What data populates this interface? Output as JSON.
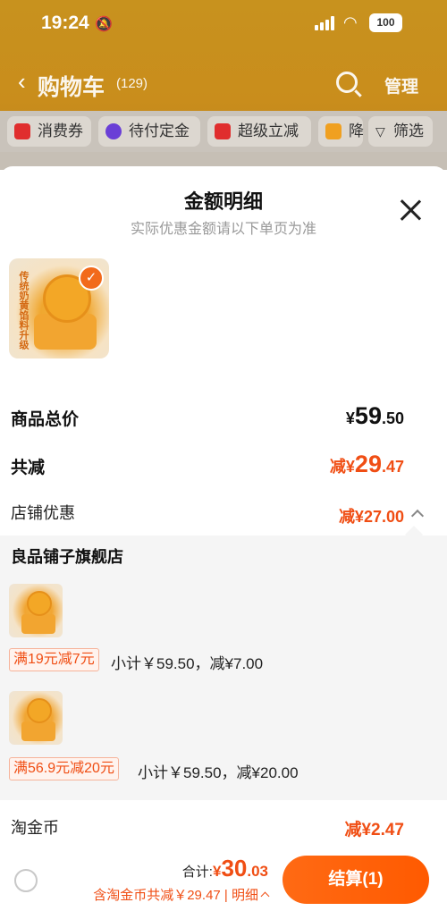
{
  "status_bar": {
    "time": "19:24",
    "battery": "100"
  },
  "nav": {
    "title": "购物车",
    "count": "(129)",
    "manage": "管理"
  },
  "chips": [
    {
      "label": "消费券",
      "color": "#e02e2e"
    },
    {
      "label": "待付定金",
      "color": "#6a3fd6"
    },
    {
      "label": "超级立减",
      "color": "#e02e2e"
    },
    {
      "label": "降",
      "color": "#f0a020"
    }
  ],
  "filter_label": "筛选",
  "sheet": {
    "title": "金额明细",
    "subtitle": "实际优惠金额请以下单页为准",
    "product_thumb_text": "传统奶黄馅料升级"
  },
  "total": {
    "label": "商品总价",
    "symbol": "¥",
    "int": "59",
    "dec": ".50"
  },
  "reduction": {
    "label": "共减",
    "prefix": "减",
    "symbol": "¥",
    "int": "29",
    "dec": ".47"
  },
  "shop_discount": {
    "label": "店铺优惠",
    "value": "减¥27.00"
  },
  "store": {
    "name": "良品铺子旗舰店",
    "items": [
      {
        "promo": "满19元减7元",
        "subtotal": "小计￥59.50，减¥7.00"
      },
      {
        "promo": "满56.9元减20元",
        "subtotal": "小计￥59.50，减¥20.00"
      }
    ]
  },
  "coins": {
    "label": "淘金币",
    "value": "减¥2.47"
  },
  "checkout": {
    "sum_label": "合计:",
    "sum_symbol": "¥",
    "sum_int": "30",
    "sum_dec": ".03",
    "detail": "含淘金币共减￥29.47 | 明细",
    "pay_button": "结算(1)"
  },
  "colors": {
    "accent": "#f04e14",
    "header": "#c8921e"
  }
}
